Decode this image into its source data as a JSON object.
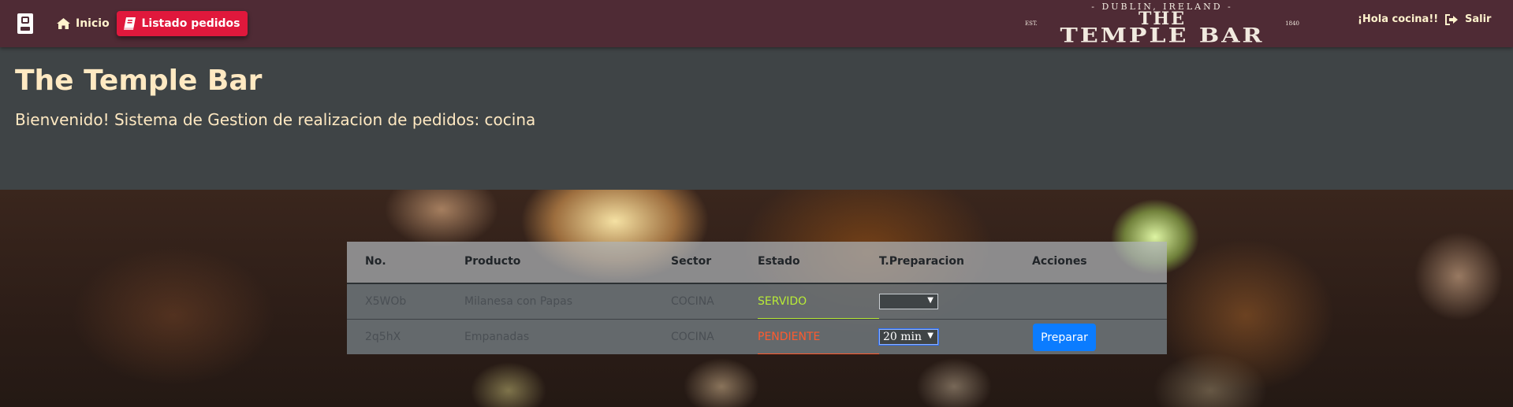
{
  "navbar": {
    "inicio_label": "Inicio",
    "listado_label": "Listado pedidos",
    "greeting": "¡Hola cocina!!",
    "salir_label": "Salir"
  },
  "logo": {
    "top": "- DUBLIN, IRELAND -",
    "est": "EST.",
    "year": "1840",
    "the": "THE",
    "name": "TEMPLE BAR"
  },
  "header": {
    "title": "The Temple Bar",
    "subtitle": "Bienvenido! Sistema de Gestion de realizacion de pedidos: cocina"
  },
  "table": {
    "columns": [
      "No.",
      "Producto",
      "Sector",
      "Estado",
      "T.Preparacion",
      "Acciones"
    ],
    "rows": [
      {
        "no": "X5WOb",
        "producto": "Milanesa con Papas",
        "sector": "COCINA",
        "estado": "SERVIDO",
        "tiempo": "",
        "accion": ""
      },
      {
        "no": "2q5hX",
        "producto": "Empanadas",
        "sector": "COCINA",
        "estado": "PENDIENTE",
        "tiempo": "20 min",
        "accion": "Preparar"
      }
    ]
  },
  "colors": {
    "navbar": "#4f2b35",
    "active_tab": "#e0183c",
    "header": "#3f4446",
    "title": "#ffe9c2",
    "served": "#b9ec36",
    "pending": "#ff5a2e",
    "button": "#0b7cff"
  },
  "icons": [
    "door-icon",
    "home-icon",
    "book-icon",
    "sign-out-icon"
  ]
}
